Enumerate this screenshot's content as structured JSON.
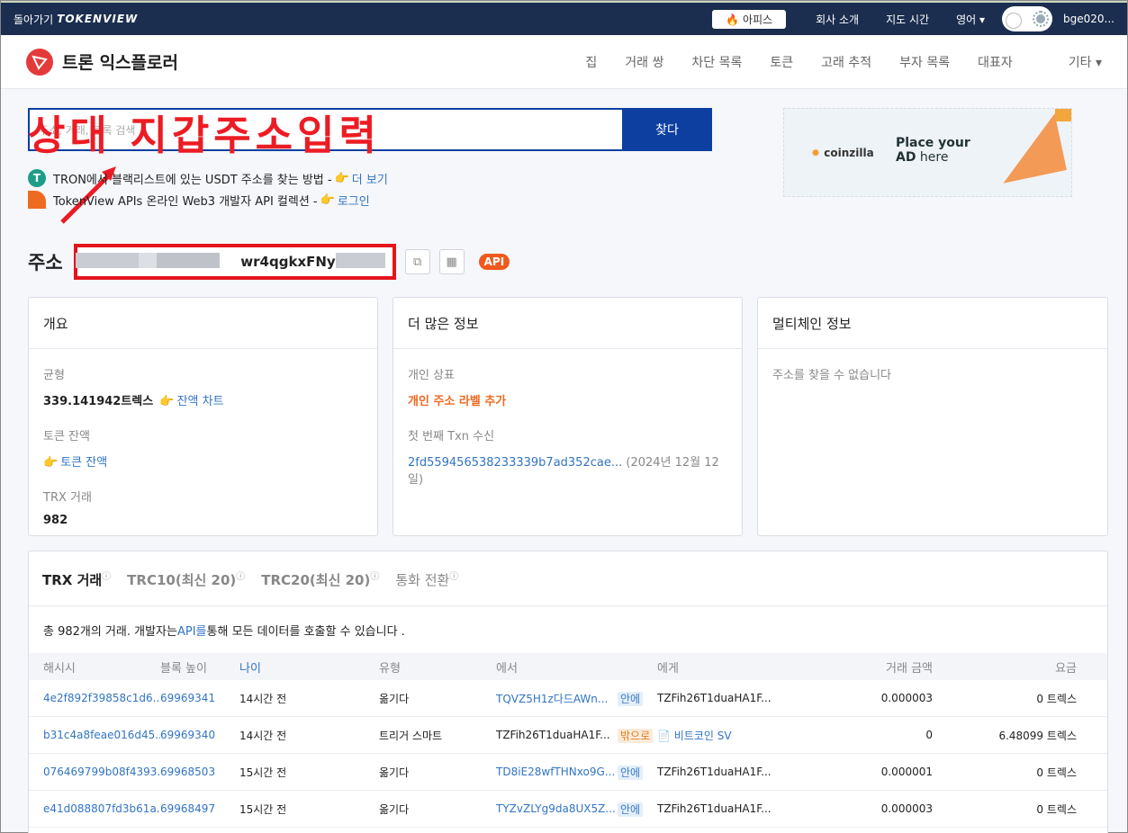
{
  "topbar": {
    "back": "돌아가기",
    "brand": "TOKENVIEW",
    "office_pill": "아피스",
    "about": "회사 소개",
    "map_time": "지도 시간",
    "language": "영어",
    "user": "bge020..."
  },
  "header": {
    "title": "트론 익스플로러",
    "nav": [
      "집",
      "거래 쌍",
      "차단 목록",
      "토큰",
      "고래 추적",
      "부자 목록",
      "대표자",
      "기타"
    ]
  },
  "search": {
    "placeholder": "주소, 거래, 블록 검색",
    "button": "찾다",
    "overlay_text": "상대 지갑주소입력"
  },
  "notes": [
    {
      "text": "TRON에서 블랙리스트에 있는 USDT 주소를 찾는 방법 -",
      "link": "더 보기"
    },
    {
      "text": "TokenView APIs 온라인 Web3 개발자 API 컬렉션 -",
      "link": "로그인"
    }
  ],
  "ad": {
    "brand": "coinzilla",
    "line1": "Place your",
    "line2_bold": "AD",
    "line2_rest": " here"
  },
  "address": {
    "label": "주소",
    "visible_part": "wr4qgkxFNyCDmw",
    "api": "API"
  },
  "overview": {
    "title": "개요",
    "balance_label": "균형",
    "balance_value": "339.141942트렉스",
    "balance_chart": "잔액 차트",
    "token_label": "토큰 잔액",
    "token_link": "토큰 잔액",
    "trx_label": "TRX 거래",
    "trx_value": "982"
  },
  "more": {
    "title": "더 많은 정보",
    "tag_label": "개인 상표",
    "tag_value": "개인 주소 라벨 추가",
    "first_label": "첫 번째 Txn 수신",
    "first_hash": "2fd559456538233339b7ad352cae...",
    "first_date": "(2024년 12월 12일)"
  },
  "multichain": {
    "title": "멀티체인 정보",
    "empty": "주소를 찾을 수 없습니다"
  },
  "tabs": [
    "TRX 거래",
    "TRC10(최신 20)",
    "TRC20(최신 20)",
    "통화 전환"
  ],
  "summary": {
    "pre": "총 982개의 거래. 개발자는 ",
    "link": "API를",
    "post": " 통해 모든 데이터를 호출할 수 있습니다 ."
  },
  "columns": [
    "해시시",
    "블록 높이",
    "나이",
    "유형",
    "에서",
    "",
    "에게",
    "거래 금액",
    "요금"
  ],
  "rows": [
    {
      "hash": "4e2f892f39858c1d6...",
      "block": "69969341",
      "age": "14시간 전",
      "type": "옮기다",
      "from": "TQVZ5H1z다드AWn...",
      "dir": "안에",
      "to": "TZFih26T1duaHA1F...",
      "amount": "0.000003",
      "fee": "0 트렉스"
    },
    {
      "hash": "b31c4a8feae016d45...",
      "block": "69969340",
      "age": "14시간 전",
      "type": "트리거 스마트",
      "from": "TZFih26T1duaHA1F...",
      "dir": "밖으로",
      "to": "비트코인 SV",
      "amount": "0",
      "fee": "6.48099 트렉스"
    },
    {
      "hash": "076469799b08f4393...",
      "block": "69968503",
      "age": "15시간 전",
      "type": "옮기다",
      "from": "TD8iE28wfTHNxo9G...",
      "dir": "안에",
      "to": "TZFih26T1duaHA1F...",
      "amount": "0.000001",
      "fee": "0 트렉스"
    },
    {
      "hash": "e41d088807fd3b61a...",
      "block": "69968497",
      "age": "15시간 전",
      "type": "옮기다",
      "from": "TYZvZLYg9da8UX5Z...",
      "dir": "안에",
      "to": "TZFih26T1duaHA1F...",
      "amount": "0.000003",
      "fee": "0 트렉스"
    }
  ]
}
